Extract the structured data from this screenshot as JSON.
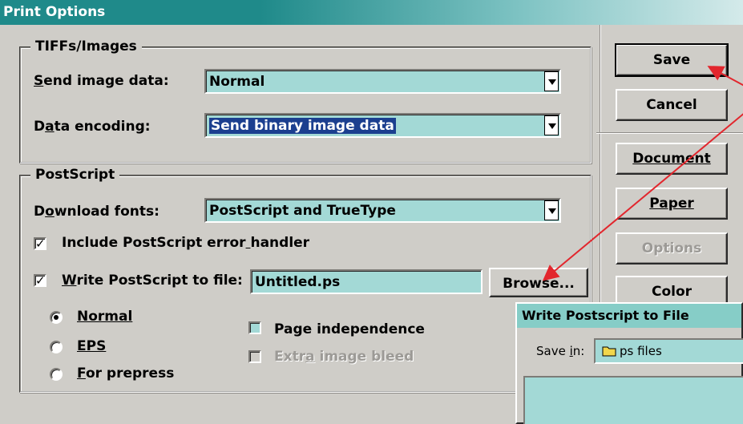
{
  "window": {
    "title": "Print Options"
  },
  "tiffs": {
    "legend": "TIFFs/Images",
    "send_image_label": "Send image data:",
    "send_image_value": "Normal",
    "encoding_label": "Data encoding:",
    "encoding_value": "Send binary image data"
  },
  "postscript": {
    "legend": "PostScript",
    "download_fonts_label": "Download fonts:",
    "download_fonts_value": "PostScript and TrueType",
    "error_handler_label": "Include PostScript error handler",
    "error_handler_checked": true,
    "write_file_label": "Write PostScript to file:",
    "write_file_checked": true,
    "file_value": "Untitled.ps",
    "browse_label": "Browse...",
    "radio_normal": "Normal",
    "radio_eps": "EPS",
    "radio_prepress": "For prepress",
    "page_independence_label": "Page independence",
    "extra_bleed_label": "Extra image bleed"
  },
  "buttons": {
    "save": "Save",
    "cancel": "Cancel",
    "document": "Document",
    "paper": "Paper",
    "options": "Options",
    "color": "Color"
  },
  "subdialog": {
    "title": "Write Postscript to File",
    "save_in_label": "Save in:",
    "save_in_value": "ps files"
  },
  "colors": {
    "title_bar": "#1f8a8a",
    "field_bg": "#a3d9d6",
    "dialog_bg": "#cfcdc8",
    "arrow": "#e2262d"
  }
}
